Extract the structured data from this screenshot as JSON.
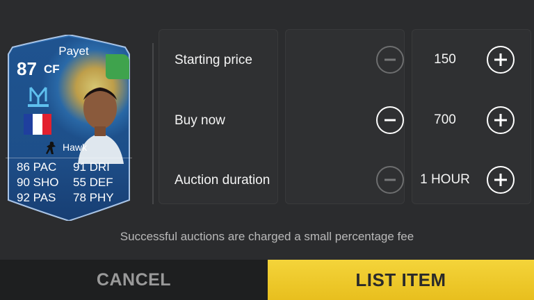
{
  "card": {
    "name": "Payet",
    "rating": "87",
    "position": "CF",
    "chemistry_style": "Hawk",
    "club_icon": "club-crest-icon",
    "nation_flag_colors": [
      "#1f3f9e",
      "#ffffff",
      "#e3202e"
    ],
    "badge_color": "#3fa34d",
    "stats": [
      [
        "86 PAC",
        "91 DRI"
      ],
      [
        "90 SHO",
        "55 DEF"
      ],
      [
        "92 PAS",
        "78 PHY"
      ]
    ]
  },
  "pricing": {
    "rows": [
      {
        "label": "Starting price",
        "value": "150",
        "minus_enabled": false
      },
      {
        "label": "Buy now",
        "value": "700",
        "minus_enabled": true
      },
      {
        "label": "Auction duration",
        "value": "1 HOUR",
        "minus_enabled": false
      }
    ]
  },
  "fee_note": "Successful auctions are charged a small percentage fee",
  "buttons": {
    "cancel": "CANCEL",
    "list_item": "LIST ITEM"
  },
  "colors": {
    "background": "#2b2c2e",
    "accent_yellow": "#f4d43a",
    "card_blue": "#1d4f8a"
  }
}
